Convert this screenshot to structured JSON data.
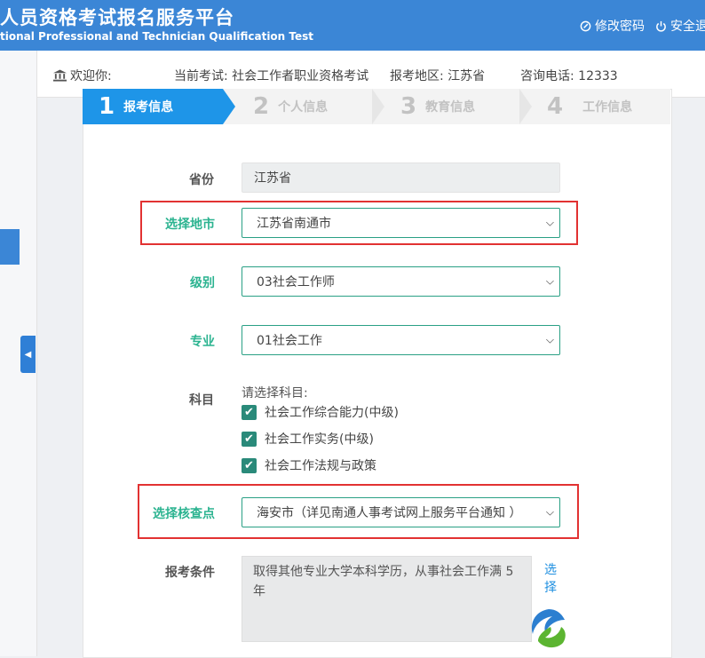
{
  "header": {
    "title_cn": "人员资格考试报名服务平台",
    "title_en": "tional Professional and Technician Qualification Test",
    "links": [
      {
        "label": "修改密码",
        "icon": "edit-icon"
      },
      {
        "label": "安全退",
        "icon": "power-icon"
      }
    ]
  },
  "infobar": {
    "welcome": "欢迎你:",
    "current_exam": "当前考试: 社会工作者职业资格考试",
    "region": "报考地区: 江苏省",
    "phone": "咨询电话:   12333"
  },
  "steps": [
    {
      "num": "1",
      "label": "报考信息",
      "active": true
    },
    {
      "num": "2",
      "label": "个人信息",
      "active": false
    },
    {
      "num": "3",
      "label": "教育信息",
      "active": false
    },
    {
      "num": "4",
      "label": "工作信息",
      "active": false
    }
  ],
  "form": {
    "province": {
      "label": "省份",
      "value": "江苏省"
    },
    "city": {
      "label": "选择地市",
      "value": "江苏省南通市"
    },
    "level": {
      "label": "级别",
      "value": "03社会工作师"
    },
    "major": {
      "label": "专业",
      "value": "01社会工作"
    },
    "subjects": {
      "label": "科目",
      "prompt": "请选择科目:",
      "items": [
        "社会工作综合能力(中级)",
        "社会工作实务(中级)",
        "社会工作法规与政策"
      ]
    },
    "checkpoint": {
      "label": "选择核查点",
      "value": "海安市（详见南通人事考试网上服务平台通知 ）"
    },
    "condition": {
      "label": "报考条件",
      "value": "取得其他专业大学本科学历，从事社会工作满 5 年",
      "pick": "选择"
    }
  },
  "colors": {
    "header": "#3b86d6",
    "active_step": "#1e95e8",
    "accent_green": "#2bb390",
    "highlight_red": "#e23232"
  }
}
